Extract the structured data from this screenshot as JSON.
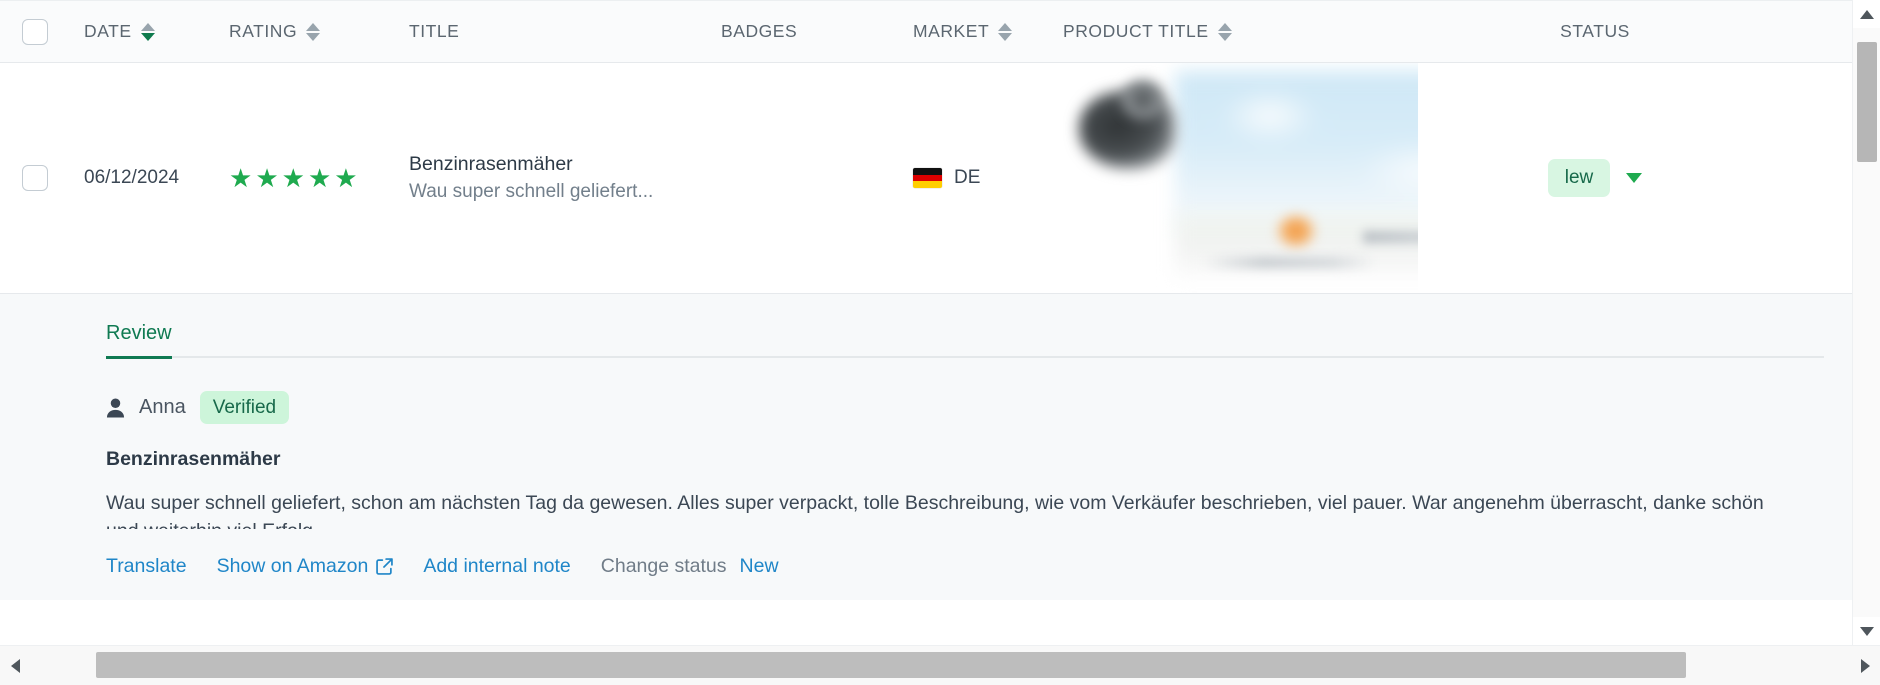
{
  "table": {
    "columns": [
      {
        "key": "checkbox",
        "label": "",
        "sortable": false
      },
      {
        "key": "date",
        "label": "DATE",
        "sortable": true,
        "sort_active": "desc"
      },
      {
        "key": "rating",
        "label": "RATING",
        "sortable": true,
        "sort_active": "none"
      },
      {
        "key": "title",
        "label": "TITLE",
        "sortable": false
      },
      {
        "key": "badges",
        "label": "BADGES",
        "sortable": false
      },
      {
        "key": "market",
        "label": "MARKET",
        "sortable": true,
        "sort_active": "none"
      },
      {
        "key": "product_title",
        "label": "PRODUCT TITLE",
        "sortable": true,
        "sort_active": "none"
      },
      {
        "key": "status",
        "label": "STATUS",
        "sortable": false
      }
    ],
    "row": {
      "selected": false,
      "date": "06/12/2024",
      "rating_stars": 5,
      "star_glyph": "★",
      "title": "Benzinrasenmäher",
      "subtitle": "Wau super schnell geliefert...",
      "badges": "",
      "market_code": "DE",
      "market_flag": "de-flag-icon",
      "product_image": "blurred-product-photo",
      "status_label": "lew",
      "status_chevron": "chevron-down-icon"
    }
  },
  "detail": {
    "tabs": [
      {
        "id": "review",
        "label": "Review",
        "active": true
      }
    ],
    "author": {
      "icon": "person-icon",
      "name": "Anna",
      "badge": "Verified"
    },
    "review_title": "Benzinrasenmäher",
    "review_body": "Wau super schnell geliefert, schon am nächsten Tag da gewesen. Alles super verpackt, tolle Beschreibung, wie vom Verkäufer beschrieben, viel pauer. War angenehm überrascht, danke schön und weiterhin viel Erfolg",
    "actions": {
      "translate": "Translate",
      "show_on_amazon": "Show on Amazon",
      "show_on_amazon_icon": "external-link-icon",
      "add_internal_note": "Add internal note",
      "change_status_label": "Change status",
      "change_status_value": "New"
    }
  },
  "scrollbars": {
    "vertical": {
      "up_icon": "triangle-up-icon",
      "down_icon": "triangle-down-icon"
    },
    "horizontal": {
      "left_icon": "triangle-left-icon",
      "right_icon": "triangle-right-icon"
    }
  },
  "colors": {
    "accent_green": "#0f7a52",
    "star_green": "#1faa4f",
    "link_blue": "#1f86c8",
    "pill_bg": "#d8f6e2",
    "header_bg": "#fafbfc",
    "detail_bg": "#f7f9fa"
  }
}
